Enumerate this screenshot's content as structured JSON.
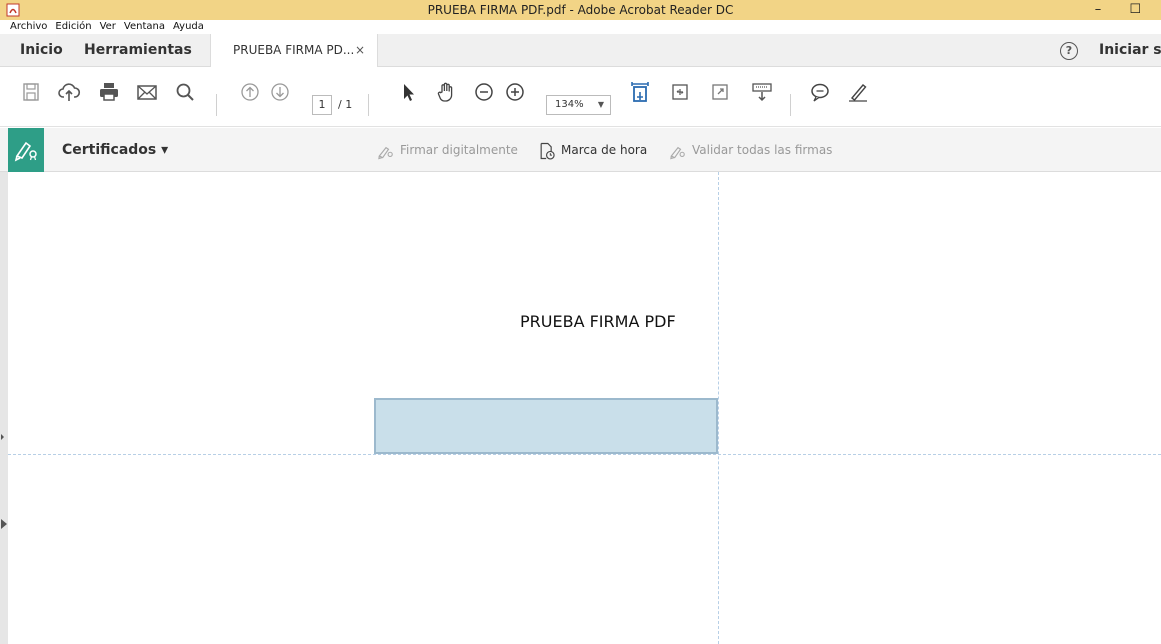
{
  "window": {
    "title": "PRUEBA FIRMA PDF.pdf - Adobe Acrobat Reader DC",
    "controls": "– ☐"
  },
  "menu": [
    "Archivo",
    "Edición",
    "Ver",
    "Ventana",
    "Ayuda"
  ],
  "tabs": {
    "inicio": "Inicio",
    "herramientas": "Herramientas",
    "document": "PRUEBA FIRMA PD...",
    "close": "×",
    "help": "?",
    "signin": "Iniciar se"
  },
  "toolbar": {
    "page_current": "1",
    "page_total": "/ 1",
    "zoom": "134%",
    "zoom_caret": "▼"
  },
  "certbar": {
    "label": "Certificados ▾",
    "sign": "Firmar digitalmente",
    "timestamp": "Marca de hora",
    "validate": "Validar todas las firmas"
  },
  "document": {
    "text": "PRUEBA FIRMA PDF"
  },
  "colors": {
    "titlebar": "#f2d486",
    "accent_green": "#2e9e87",
    "sigfield": "#c9dfea"
  }
}
